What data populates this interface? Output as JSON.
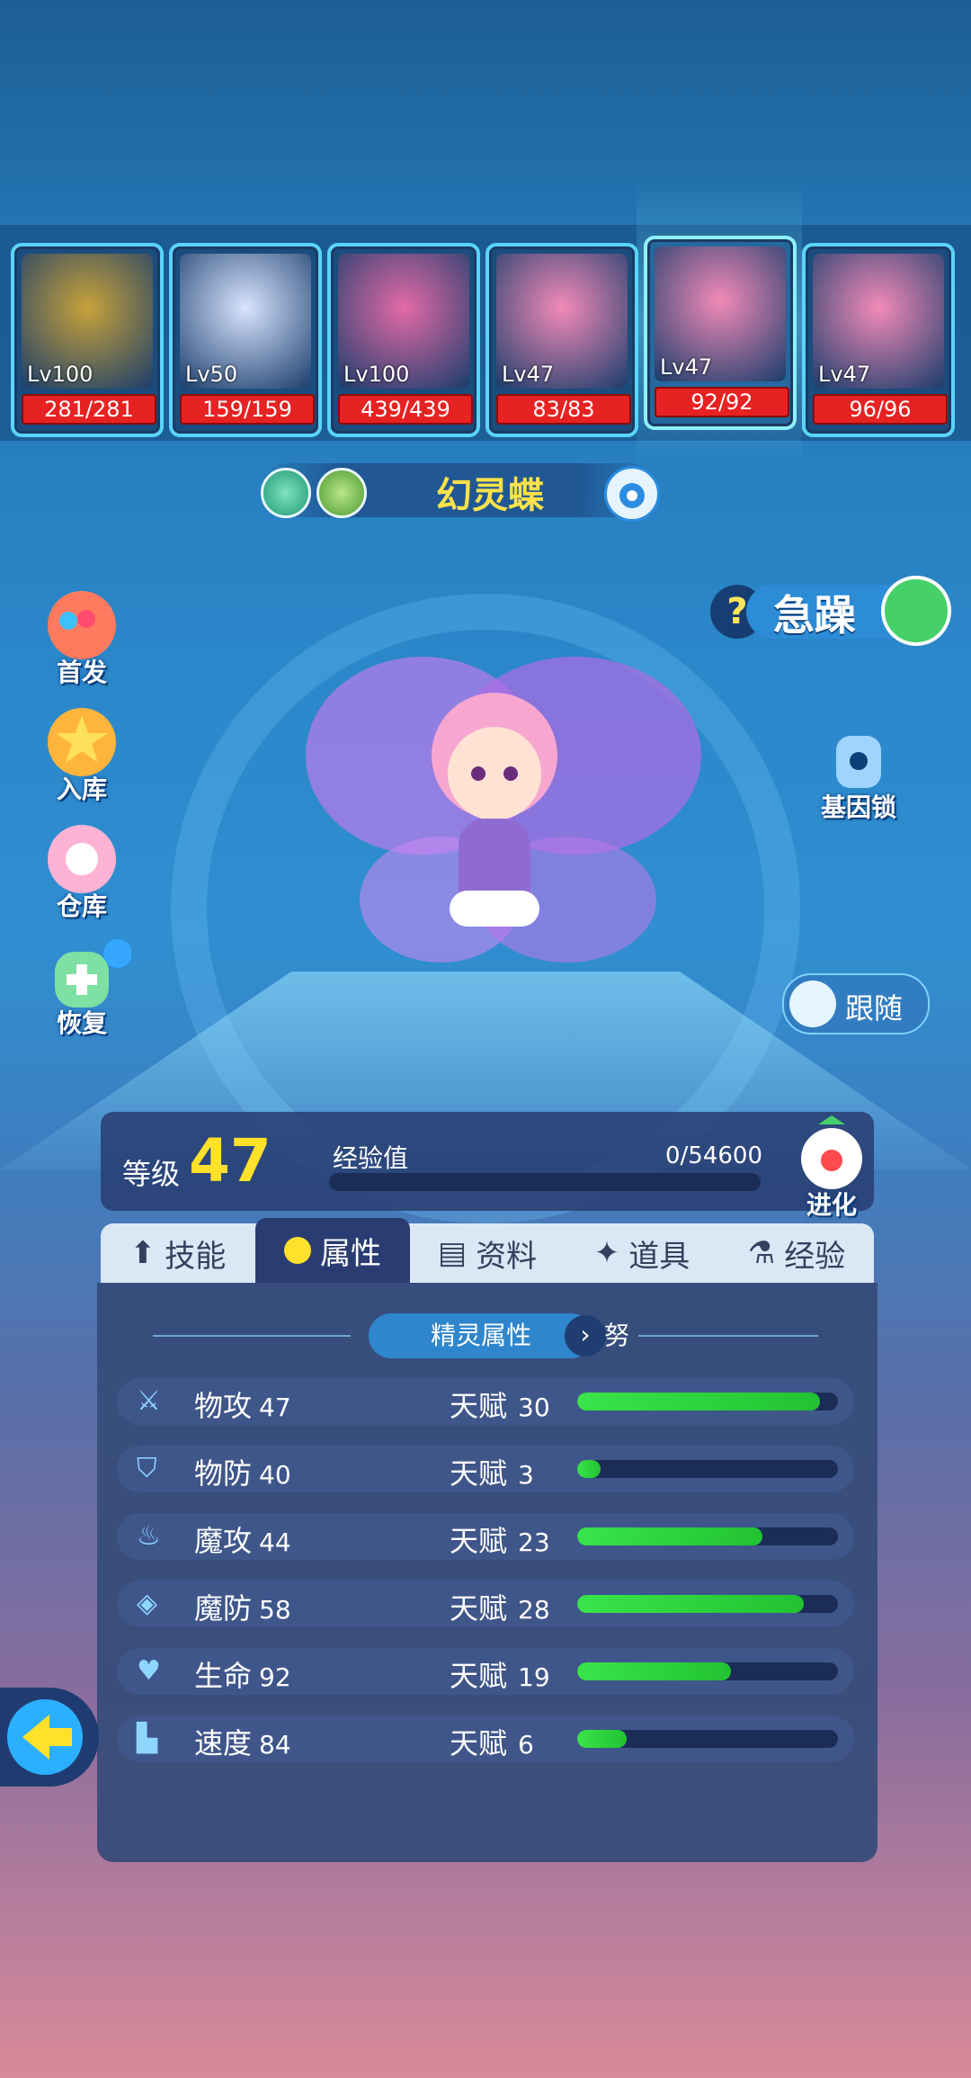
{
  "team": [
    {
      "level": "Lv100",
      "hp": "281/281",
      "theme": "#c7a23a"
    },
    {
      "level": "Lv50",
      "hp": "159/159",
      "theme": "#d8e4ff"
    },
    {
      "level": "Lv100",
      "hp": "439/439",
      "theme": "#e26aa7"
    },
    {
      "level": "Lv47",
      "hp": "83/83",
      "theme": "#f28ab8"
    },
    {
      "level": "Lv47",
      "hp": "92/92",
      "theme": "#f28ab8",
      "active": true
    },
    {
      "level": "Lv47",
      "hp": "96/96",
      "theme": "#f28ab8"
    }
  ],
  "pet": {
    "name": "幻灵蝶",
    "mood": "急躁"
  },
  "side_buttons": {
    "first": "首发",
    "store": "入库",
    "warehouse": "仓库",
    "restore": "恢复",
    "gene_lock": "基因锁",
    "follow": "跟随"
  },
  "level_panel": {
    "level_label": "等级",
    "level": "47",
    "exp_label": "经验值",
    "exp_value": "0/54600",
    "exp_progress": 0,
    "evolve_label": "进化"
  },
  "tabs": [
    {
      "label": "技能",
      "icon": "up-arrow-icon"
    },
    {
      "label": "属性",
      "icon": "hex-icon",
      "active": true
    },
    {
      "label": "资料",
      "icon": "clipboard-icon"
    },
    {
      "label": "道具",
      "icon": "star-item-icon"
    },
    {
      "label": "经验",
      "icon": "flask-icon"
    }
  ],
  "attributes": {
    "section_title": "精灵属性",
    "section_extra": "努",
    "rows": [
      {
        "name": "物攻",
        "value": "47",
        "talent_label": "天赋",
        "talent": "30",
        "talent_ratio": 0.93,
        "icon": "sword-icon"
      },
      {
        "name": "物防",
        "value": "40",
        "talent_label": "天赋",
        "talent": "3",
        "talent_ratio": 0.09,
        "icon": "shield-icon"
      },
      {
        "name": "魔攻",
        "value": "44",
        "talent_label": "天赋",
        "talent": "23",
        "talent_ratio": 0.71,
        "icon": "flame-icon"
      },
      {
        "name": "魔防",
        "value": "58",
        "talent_label": "天赋",
        "talent": "28",
        "talent_ratio": 0.87,
        "icon": "magic-shield-icon"
      },
      {
        "name": "生命",
        "value": "92",
        "talent_label": "天赋",
        "talent": "19",
        "talent_ratio": 0.59,
        "icon": "heart-plus-icon"
      },
      {
        "name": "速度",
        "value": "84",
        "talent_label": "天赋",
        "talent": "6",
        "talent_ratio": 0.19,
        "icon": "boot-icon"
      }
    ]
  }
}
